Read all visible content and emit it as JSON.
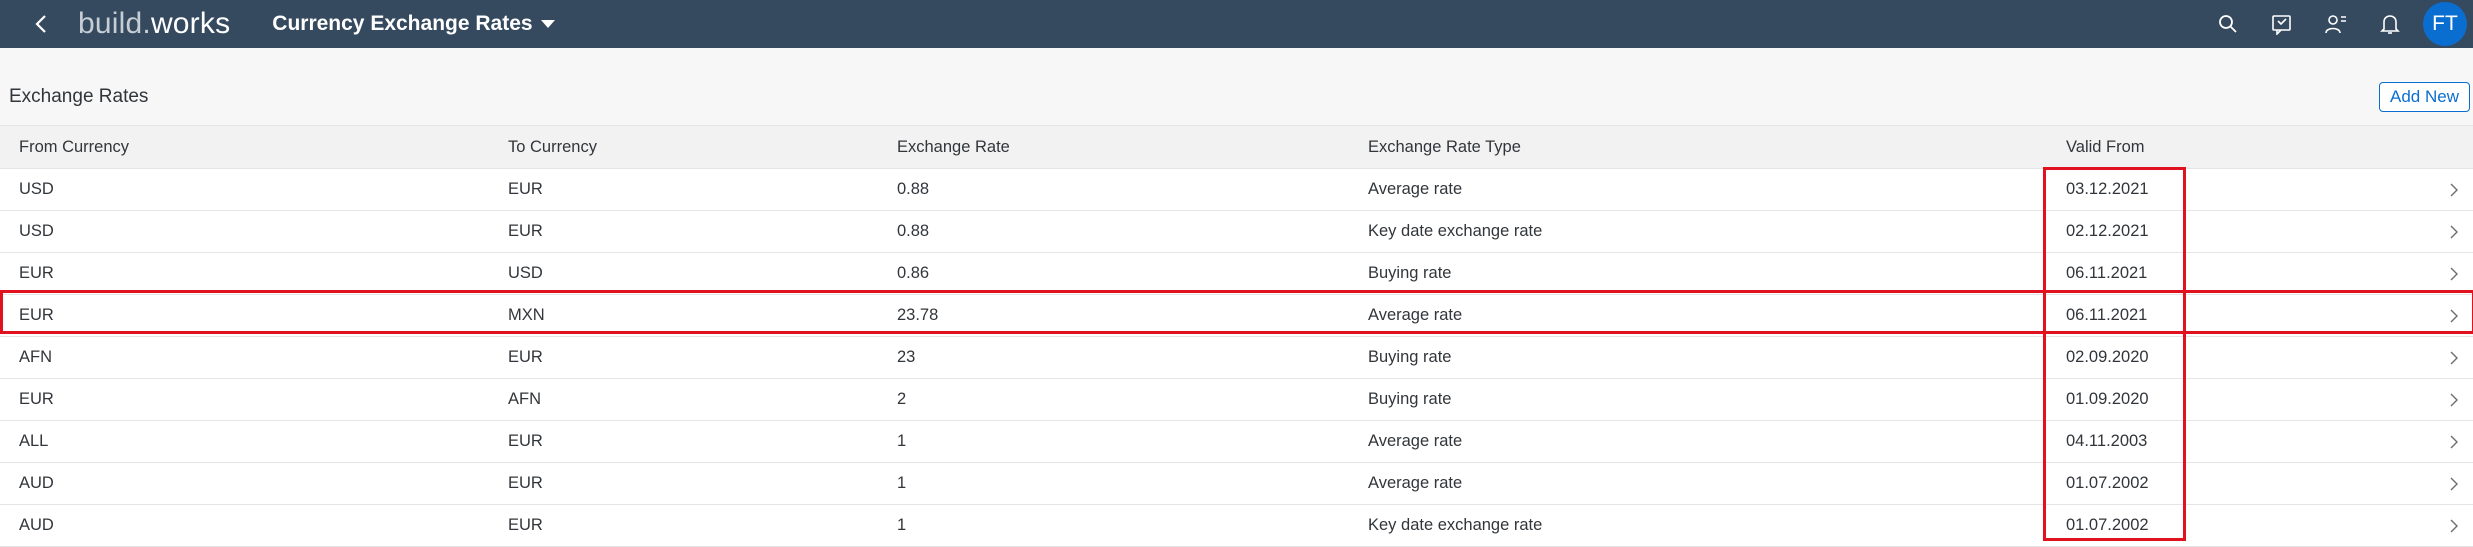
{
  "shell": {
    "logo_prefix": "build",
    "logo_dot": ".",
    "logo_suffix": "works",
    "app_title": "Currency Exchange Rates",
    "avatar_initials": "FT"
  },
  "section": {
    "title": "Exchange Rates",
    "add_button": "Add New"
  },
  "table": {
    "columns": [
      "From Currency",
      "To Currency",
      "Exchange Rate",
      "Exchange Rate Type",
      "Valid From"
    ],
    "rows": [
      {
        "from": "USD",
        "to": "EUR",
        "rate": "0.88",
        "type": "Average rate",
        "valid_from": "03.12.2021"
      },
      {
        "from": "USD",
        "to": "EUR",
        "rate": "0.88",
        "type": "Key date exchange rate",
        "valid_from": "02.12.2021"
      },
      {
        "from": "EUR",
        "to": "USD",
        "rate": "0.86",
        "type": "Buying rate",
        "valid_from": "06.11.2021"
      },
      {
        "from": "EUR",
        "to": "MXN",
        "rate": "23.78",
        "type": "Average rate",
        "valid_from": "06.11.2021"
      },
      {
        "from": "AFN",
        "to": "EUR",
        "rate": "23",
        "type": "Buying rate",
        "valid_from": "02.09.2020"
      },
      {
        "from": "EUR",
        "to": "AFN",
        "rate": "2",
        "type": "Buying rate",
        "valid_from": "01.09.2020"
      },
      {
        "from": "ALL",
        "to": "EUR",
        "rate": "1",
        "type": "Average rate",
        "valid_from": "04.11.2003"
      },
      {
        "from": "AUD",
        "to": "EUR",
        "rate": "1",
        "type": "Average rate",
        "valid_from": "01.07.2002"
      },
      {
        "from": "AUD",
        "to": "EUR",
        "rate": "1",
        "type": "Key date exchange rate",
        "valid_from": "01.07.2002"
      }
    ]
  },
  "colors": {
    "shell_bg": "#354a5f",
    "accent": "#0a6ed1",
    "highlight": "#e0121f"
  },
  "icons": [
    "back-icon",
    "search-icon",
    "guided-tour-icon",
    "user-settings-icon",
    "notifications-icon",
    "chevron-right-icon"
  ]
}
